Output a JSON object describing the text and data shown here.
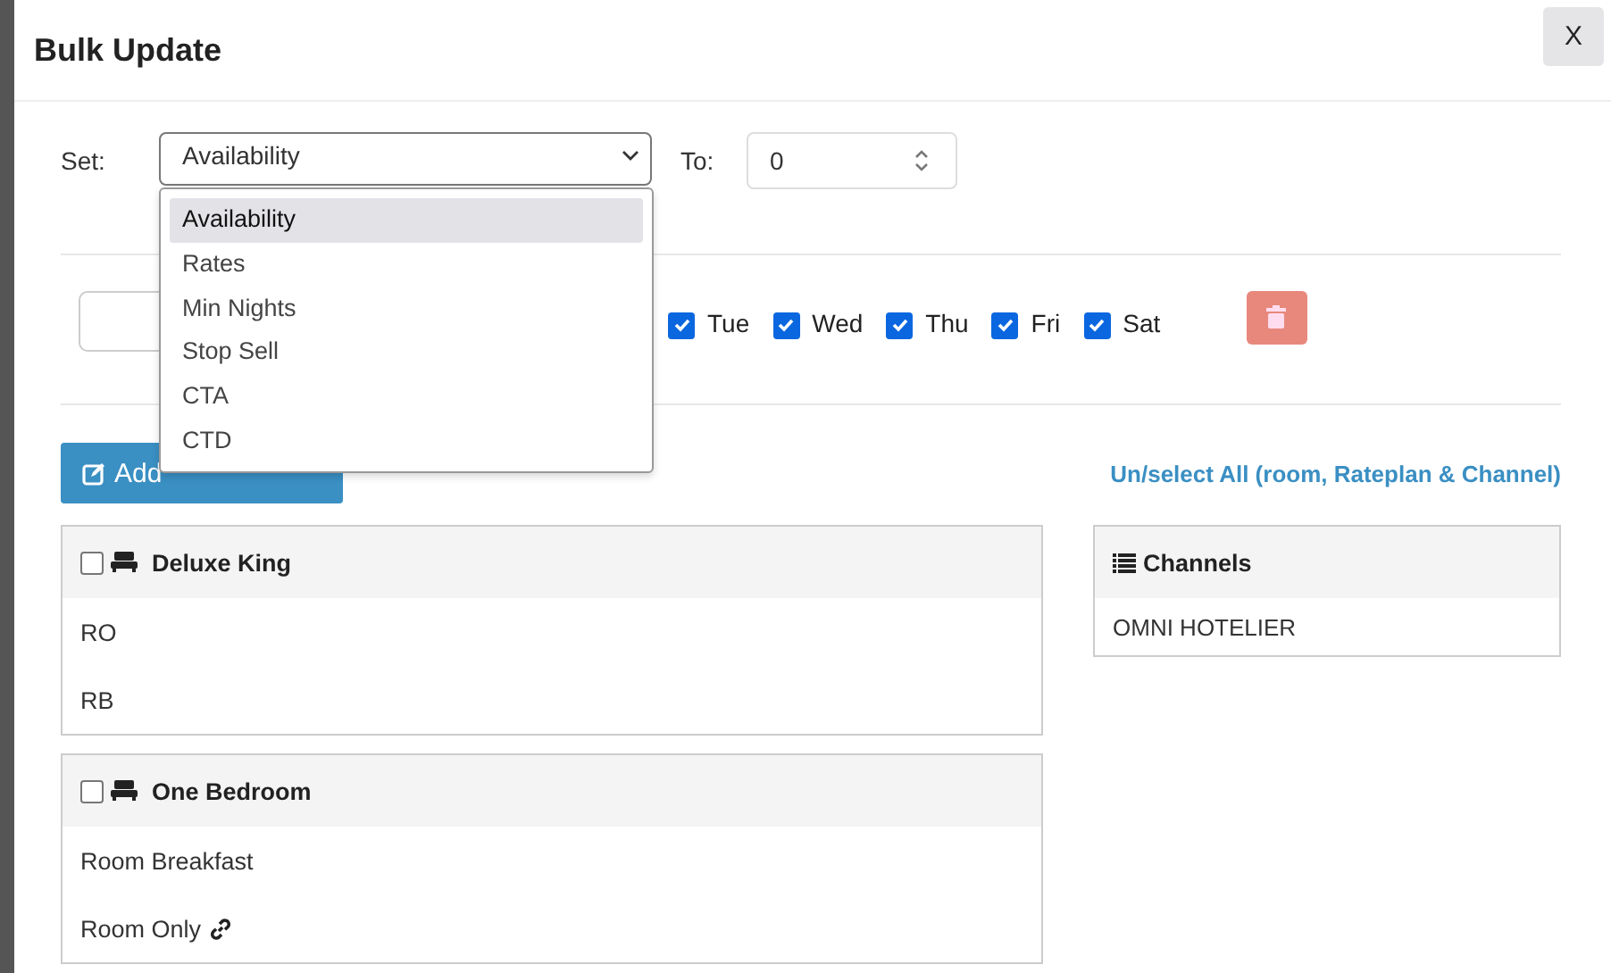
{
  "modal": {
    "title": "Bulk Update",
    "close_label": "X"
  },
  "set_row": {
    "set_label": "Set:",
    "select_value": "Availability",
    "to_label": "To:",
    "to_value": "0"
  },
  "dropdown": {
    "expanded": true,
    "options": [
      {
        "label": "Availability",
        "selected": true
      },
      {
        "label": "Rates",
        "selected": false
      },
      {
        "label": "Min Nights",
        "selected": false
      },
      {
        "label": "Stop Sell",
        "selected": false
      },
      {
        "label": "CTA",
        "selected": false
      },
      {
        "label": "CTD",
        "selected": false
      }
    ]
  },
  "days": [
    {
      "label": "Tue",
      "checked": true
    },
    {
      "label": "Wed",
      "checked": true
    },
    {
      "label": "Thu",
      "checked": true
    },
    {
      "label": "Fri",
      "checked": true
    },
    {
      "label": "Sat",
      "checked": true
    }
  ],
  "add_date_range": "Add",
  "unselect_all": "Un/select All (room, Rateplan & Channel)",
  "rooms": [
    {
      "name": "Deluxe King",
      "checked": false,
      "rateplans": [
        {
          "name": "RO",
          "linked": false
        },
        {
          "name": "RB",
          "linked": false
        }
      ]
    },
    {
      "name": "One Bedroom",
      "checked": false,
      "rateplans": [
        {
          "name": "Room Breakfast",
          "linked": false
        },
        {
          "name": "Room Only",
          "linked": true
        }
      ]
    }
  ],
  "channels": {
    "title": "Channels",
    "items": [
      "OMNI HOTELIER"
    ]
  }
}
